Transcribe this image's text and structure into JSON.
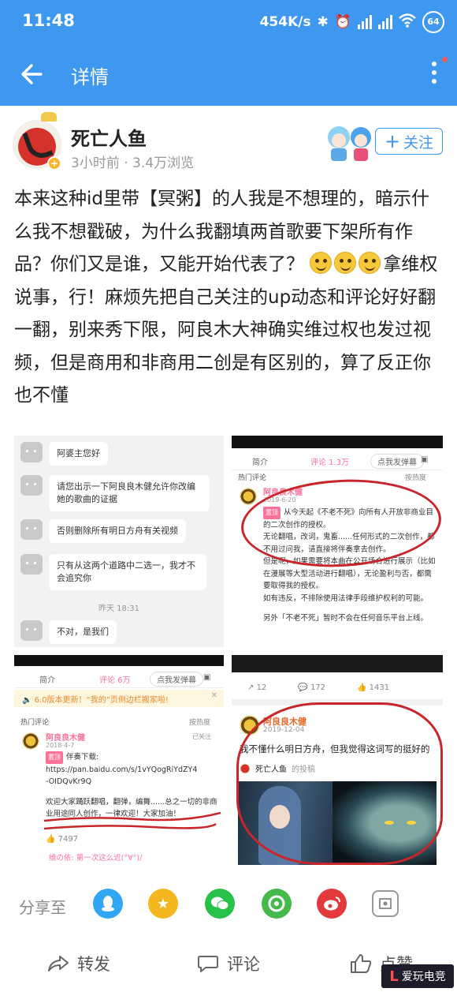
{
  "status_bar": {
    "time": "11:48",
    "net_speed": "454K/s",
    "battery": "64"
  },
  "app_bar": {
    "title": "详情"
  },
  "post": {
    "author": "死亡人鱼",
    "meta": "3小时前 · 3.4万浏览",
    "follow_label": "关注",
    "text_part1": "本来这种id里带【冥粥】的人我是不想理的，暗示什么我不想戳破，为什么我翻填两首歌要下架所有作品？你们又是谁，又能开始代表了？",
    "text_part2": "拿维权说事，行！麻烦先把自己关注的up动态和评论好好翻一翻，别来秀下限，阿良木大神确实维过权也发过视频，但是商用和非商用二创是有区别的，算了反正你也不懂"
  },
  "image1": {
    "messages": [
      "阿婆主您好",
      "请您出示一下阿良良木健允许你改编她的歌曲的证据",
      "否则删除所有明日方舟有关视频",
      "只有从这两个道路中二选一，我才不会追究你",
      "不对，是我们"
    ],
    "timestamp": "昨天 18:31"
  },
  "image2": {
    "tab_intro": "简介",
    "tab_comments": "评论 1.3万",
    "danmaku": "点我发弹幕",
    "hot": "热门评论",
    "sort": "按热度",
    "commenter": "阿良良木健",
    "date": "2019-6-20",
    "top_tag": "置顶",
    "lines": [
      "从今天起《不老不死》向所有人开放非商业目的二次创作的授权。",
      "无论翻唱，改词，鬼畜......任何形式的二次创作，都不用过问我，请直接将伴奏拿去创作。",
      "但是呢，如果需要将本曲在公开场合进行展示（比如在漫展等大型活动进行翻唱），无论盈利与否，都需要取得我的授权。",
      "如有违反，不排除使用法律手段维护权利的可能。",
      "另外「不老不死」暂时不会在任何音乐平台上线。"
    ]
  },
  "image3": {
    "tab_intro": "简介",
    "tab_comments": "评论 6万",
    "danmaku": "点我发弹幕",
    "notice": "6.0版本更新！“我的”页侧边栏搬家啦!",
    "hot": "热门评论",
    "sort": "按热度",
    "commenter": "阿良良木健",
    "date": "2018-4-7",
    "followed": "已关注",
    "top_tag": "置顶",
    "lines": [
      "伴奏下载:",
      "https://pan.baidu.com/s/1vYQogRiYdZY4",
      "-OIDQvKr9Q",
      "欢迎大家踊跃翻唱，翻弹，编舞......总之一切的非商",
      "业用途同人创作，一律欢迎！大家加油！"
    ],
    "likes": "7497",
    "reply": "维の依: 第一次这么近(°∀°)/"
  },
  "image4": {
    "counts": [
      "12",
      "172",
      "1431"
    ],
    "name": "阿良良木健",
    "date": "2019-12-04",
    "text": "我不懂什么明日方舟，但我觉得这词写的挺好的",
    "src_name": "死亡人鱼",
    "src_tag": "的投稿"
  },
  "share": {
    "label": "分享至"
  },
  "actions": {
    "repost": "转发",
    "comment": "评论",
    "like": "点赞"
  },
  "watermark": {
    "text": "爱玩电竞"
  }
}
